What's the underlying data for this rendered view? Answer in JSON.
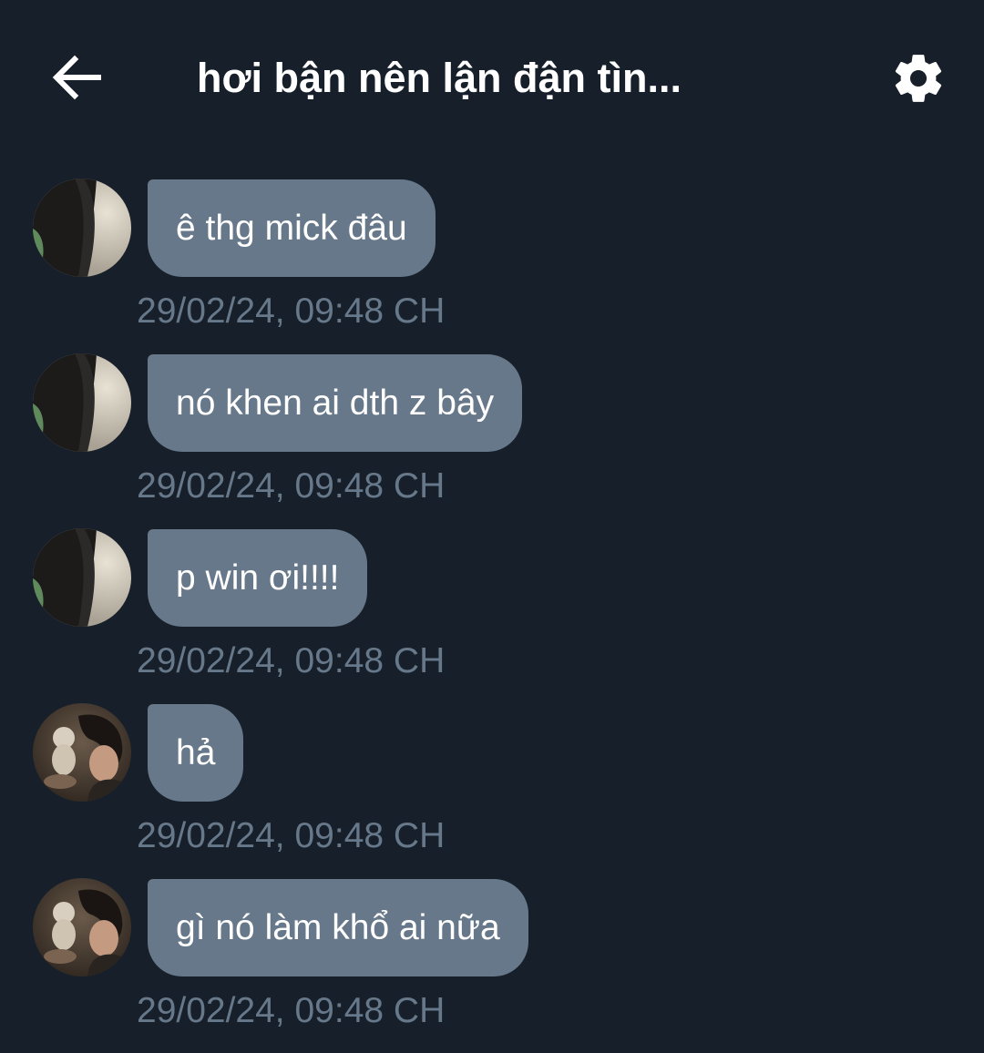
{
  "header": {
    "title": "hơi bận nên lận đận tìn..."
  },
  "messages": [
    {
      "avatar": "avatar-dark-hoodie",
      "text": "ê thg mick đâu",
      "time": "29/02/24, 09:48 CH"
    },
    {
      "avatar": "avatar-dark-hoodie",
      "text": "nó khen ai dth z bây",
      "time": "29/02/24, 09:48 CH"
    },
    {
      "avatar": "avatar-dark-hoodie",
      "text": "p win ơi!!!!",
      "time": "29/02/24, 09:48 CH"
    },
    {
      "avatar": "avatar-man-with-plush",
      "text": "hả",
      "time": "29/02/24, 09:48 CH"
    },
    {
      "avatar": "avatar-man-with-plush",
      "text": "gì nó làm khổ ai nữa",
      "time": "29/02/24, 09:48 CH"
    }
  ],
  "colors": {
    "background": "#17202a",
    "bubble": "#66788a",
    "timestamp": "#66788a",
    "text": "#ffffff"
  },
  "icons": {
    "back": "arrow-left-icon",
    "settings": "gear-icon"
  }
}
